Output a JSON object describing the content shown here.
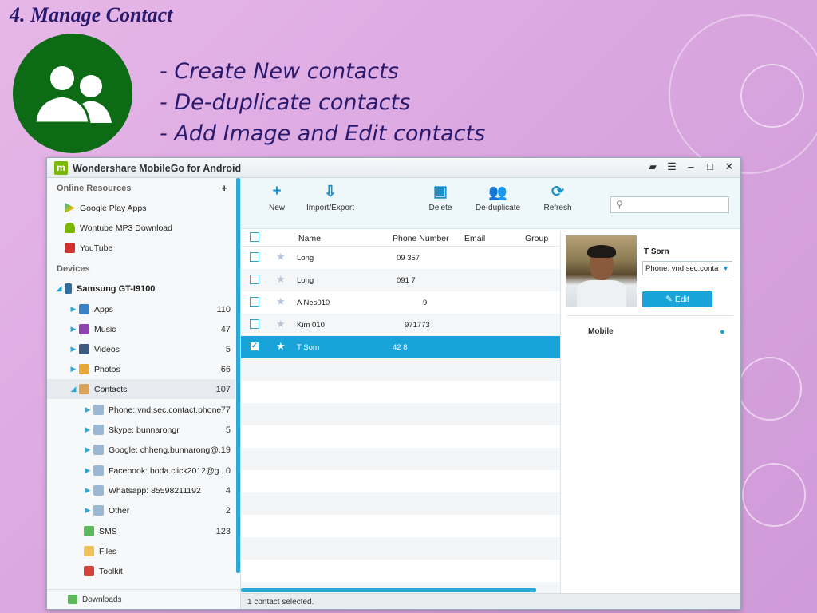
{
  "slide": {
    "title": "4. Manage Contact",
    "bullets": [
      "- Create New contacts",
      "- De-duplicate contacts",
      "- Add Image and Edit contacts"
    ]
  },
  "window": {
    "title": "Wondershare MobileGo for Android",
    "logo_text": "m"
  },
  "sidebar": {
    "online_header": "Online Resources",
    "add_symbol": "+",
    "online_items": [
      {
        "label": "Google Play Apps"
      },
      {
        "label": "Wontube MP3 Download"
      },
      {
        "label": "YouTube"
      }
    ],
    "devices_header": "Devices",
    "device_name": "Samsung GT-I9100",
    "device_items": [
      {
        "label": "Apps",
        "count": "110"
      },
      {
        "label": "Music",
        "count": "47"
      },
      {
        "label": "Videos",
        "count": "5"
      },
      {
        "label": "Photos",
        "count": "66"
      },
      {
        "label": "Contacts",
        "count": "107"
      }
    ],
    "contact_accounts": [
      {
        "label": "Phone: vnd.sec.contact.phone",
        "count": "77"
      },
      {
        "label": "Skype: bunnarongr",
        "count": "5"
      },
      {
        "label": "Google: chheng.bunnarong@...",
        "count": "19"
      },
      {
        "label": "Facebook: hoda.click2012@g...",
        "count": "0"
      },
      {
        "label": "Whatsapp: 85598211192",
        "count": "4"
      },
      {
        "label": "Other",
        "count": "2"
      }
    ],
    "tail_items": [
      {
        "label": "SMS",
        "count": "123"
      },
      {
        "label": "Files",
        "count": ""
      },
      {
        "label": "Toolkit",
        "count": ""
      }
    ],
    "downloads": "Downloads"
  },
  "toolbar": {
    "new": "New",
    "import_export": "Import/Export",
    "delete": "Delete",
    "deduplicate": "De-duplicate",
    "refresh": "Refresh"
  },
  "grid": {
    "headers": {
      "name": "Name",
      "phone": "Phone Number",
      "email": "Email",
      "group": "Group"
    },
    "rows": [
      {
        "name": "Long",
        "phone": "09 357"
      },
      {
        "name": "Long",
        "phone": "091 7"
      },
      {
        "name": "A Nes010",
        "phone": "9"
      },
      {
        "name": "Kim 010",
        "phone": "971773"
      },
      {
        "name": "T Sorn",
        "phone": "42 8"
      }
    ]
  },
  "status": "1 contact selected.",
  "detail": {
    "name": "T Sorn",
    "account": "Phone: vnd.sec.conta",
    "edit": "Edit",
    "mobile_label": "Mobile"
  },
  "colors": {
    "accent": "#18a4d9",
    "badge": "#0d6b16"
  }
}
